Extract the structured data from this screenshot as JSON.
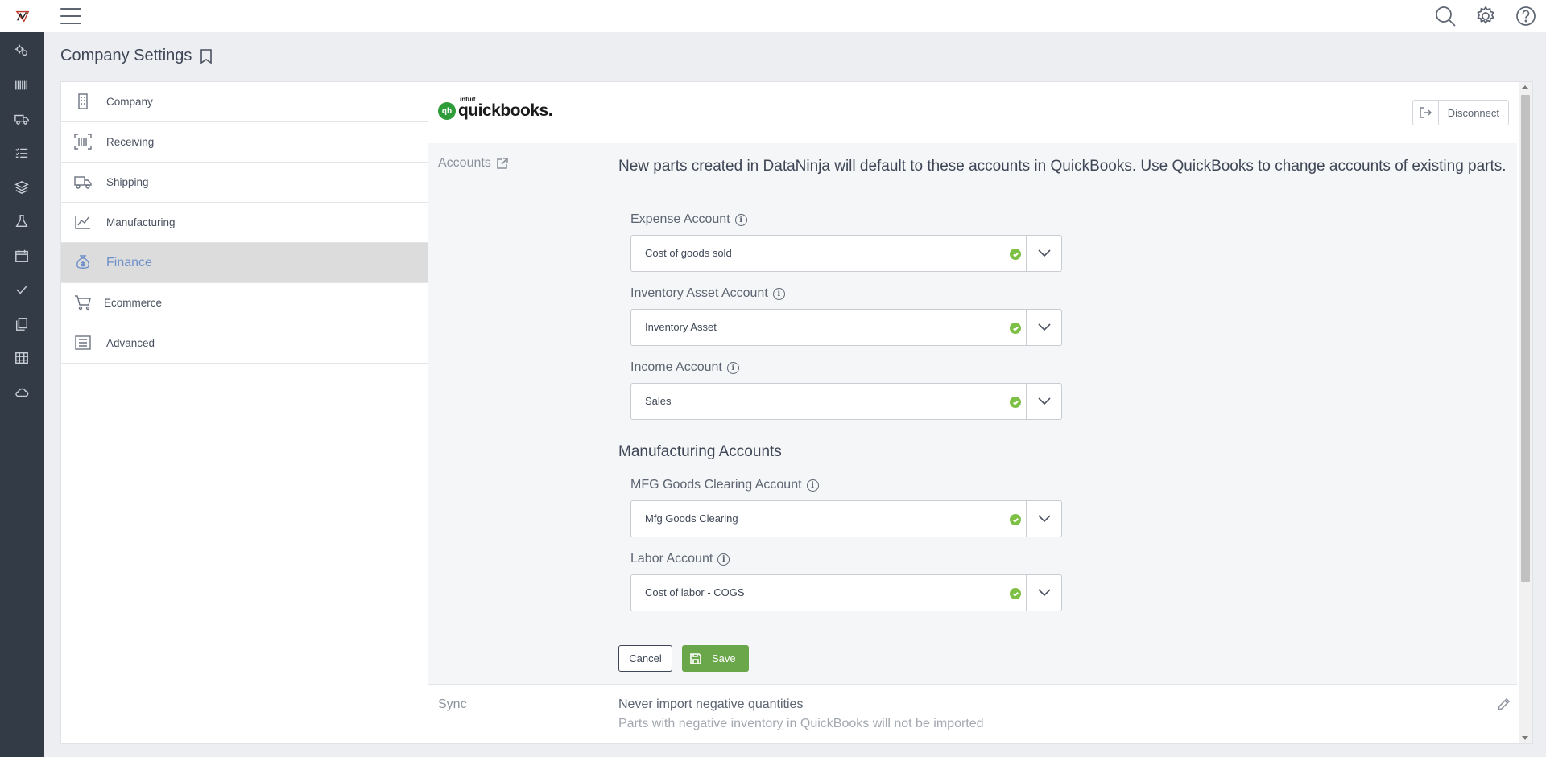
{
  "page": {
    "title": "Company Settings"
  },
  "rail": {
    "icons": [
      "gears-icon",
      "barcode-icon",
      "truck-icon",
      "checklist-icon",
      "layers-icon",
      "flask-icon",
      "calendar-icon",
      "check-icon",
      "copy-icon",
      "table-icon",
      "cloud-icon"
    ]
  },
  "topbar": {
    "icons": [
      "search-icon",
      "gear-icon",
      "help-icon"
    ]
  },
  "menu": {
    "items": [
      {
        "label": "Company",
        "icon": "building-icon"
      },
      {
        "label": "Receiving",
        "icon": "barcode-scan-icon"
      },
      {
        "label": "Shipping",
        "icon": "truck-icon"
      },
      {
        "label": "Manufacturing",
        "icon": "chart-icon"
      },
      {
        "label": "Finance",
        "icon": "money-bag-icon",
        "active": true
      },
      {
        "label": "Ecommerce",
        "icon": "cart-icon"
      },
      {
        "label": "Advanced",
        "icon": "list-icon"
      }
    ]
  },
  "integration": {
    "logo_word": "quickbooks.",
    "logo_small": "intuit",
    "logo_badge": "qb",
    "disconnect_label": "Disconnect"
  },
  "accounts": {
    "section_label": "Accounts",
    "intro": "New parts created in DataNinja will default to these accounts in QuickBooks. Use QuickBooks to change accounts of existing parts.",
    "fields": [
      {
        "label": "Expense Account",
        "value": "Cost of goods sold"
      },
      {
        "label": "Inventory Asset Account",
        "value": "Inventory Asset"
      },
      {
        "label": "Income Account",
        "value": "Sales"
      }
    ],
    "mfg_heading": "Manufacturing Accounts",
    "mfg_fields": [
      {
        "label": "MFG Goods Clearing Account",
        "value": "Mfg Goods Clearing"
      },
      {
        "label": "Labor Account",
        "value": "Cost of labor - COGS"
      }
    ],
    "info_glyph": "i",
    "cancel_label": "Cancel",
    "save_label": "Save"
  },
  "sync": {
    "section_label": "Sync",
    "title": "Never import negative quantities",
    "description": "Parts with negative inventory in QuickBooks will not be imported"
  },
  "colors": {
    "rail_bg": "#333b46",
    "active_menu_text": "#6f90c9",
    "save_green": "#6aa74a",
    "check_green": "#7ec045"
  }
}
